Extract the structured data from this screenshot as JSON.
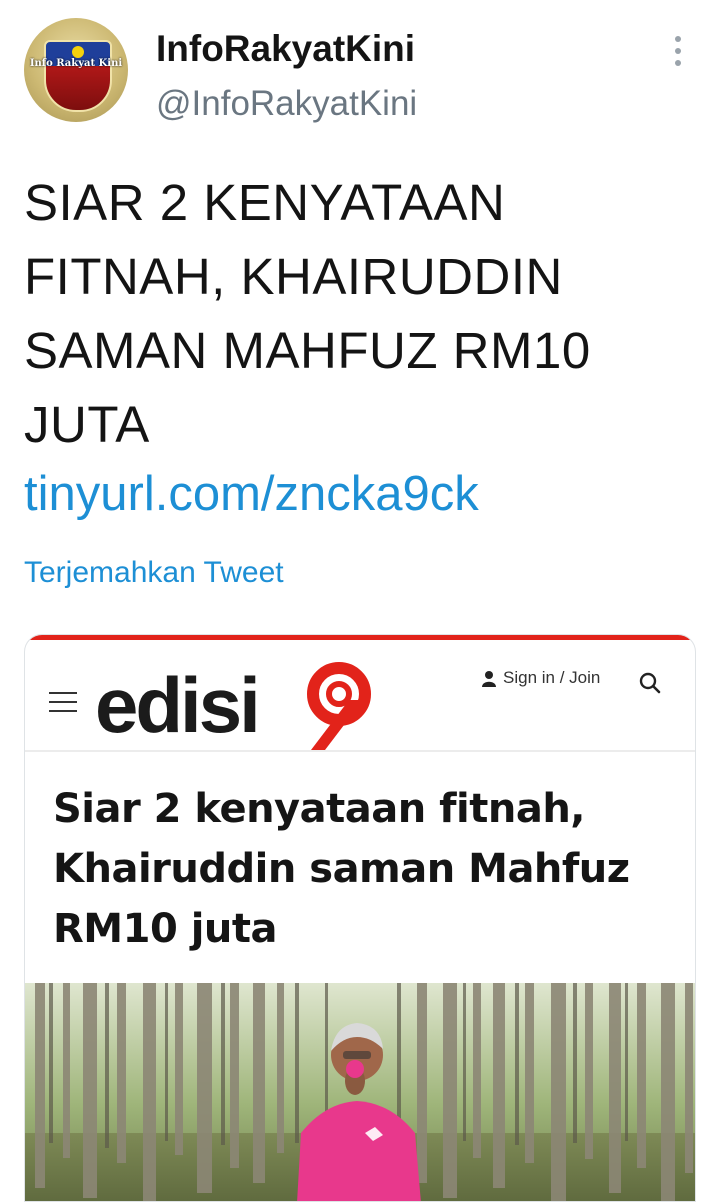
{
  "tweet": {
    "display_name": "InfoRakyatKini",
    "handle": "@InfoRakyatKini",
    "avatar_text": "Info Rakyat Kini",
    "text": "SIAR 2 KENYATAAN FITNAH, KHAIRUDDIN SAMAN MAHFUZ RM10 JUTA",
    "link": "tinyurl.com/zncka9ck",
    "translate_label": "Terjemahkan Tweet"
  },
  "card": {
    "site_logo": "edisi",
    "site_logo_suffix": "9",
    "signin_label": "Sign in / Join",
    "headline": "Siar 2 kenyataan fitnah, Khairuddin saman Mahfuz RM10 juta"
  },
  "colors": {
    "link": "#1d8fd5",
    "brand_red": "#e2231a",
    "shirt_pink": "#e8388c"
  },
  "icons": [
    "more-vertical-icon",
    "menu-icon",
    "user-icon",
    "search-icon"
  ]
}
